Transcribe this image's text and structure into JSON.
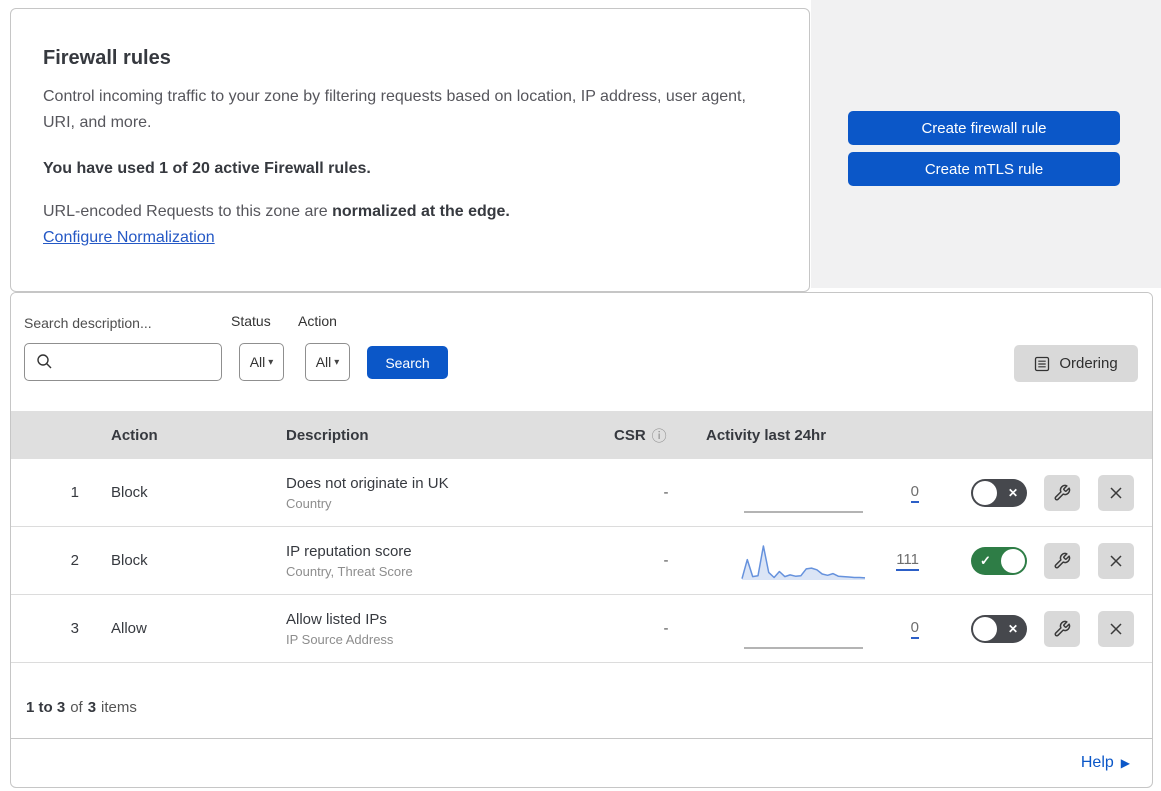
{
  "header": {
    "title": "Firewall rules",
    "description": "Control incoming traffic to your zone by filtering requests based on location, IP address, user agent, URI, and more.",
    "usage": "You have used 1 of 20 active Firewall rules.",
    "normalization_prefix": "URL-encoded Requests to this zone are ",
    "normalization_bold": "normalized at the edge.",
    "normalization_link": "Configure Normalization"
  },
  "actions_panel": {
    "create_firewall_label": "Create firewall rule",
    "create_mtls_label": "Create mTLS rule"
  },
  "filters": {
    "search_label": "Search description...",
    "status_label": "Status",
    "status_value": "All",
    "action_label": "Action",
    "action_value": "All",
    "search_button_label": "Search",
    "ordering_label": "Ordering"
  },
  "table": {
    "headers": {
      "action": "Action",
      "description": "Description",
      "csr": "CSR",
      "activity": "Activity last 24hr"
    },
    "rows": [
      {
        "priority": "1",
        "action": "Block",
        "description": "Does not originate in UK",
        "criteria": "Country",
        "csr": "-",
        "activity_count": "0",
        "enabled": false,
        "sparkline": []
      },
      {
        "priority": "2",
        "action": "Block",
        "description": "IP reputation score",
        "criteria": "Country, Threat Score",
        "csr": "-",
        "activity_count": "111",
        "enabled": true,
        "sparkline": [
          0.3,
          4.8,
          0.8,
          1.0,
          8,
          1.8,
          0.6,
          2.0,
          0.8,
          1.2,
          0.9,
          1.0,
          2.6,
          2.8,
          2.4,
          1.4,
          1.1,
          1.5,
          0.9,
          0.8,
          0.7,
          0.6,
          0.6,
          0.5
        ]
      },
      {
        "priority": "3",
        "action": "Allow",
        "description": "Allow listed IPs",
        "criteria": "IP Source Address",
        "csr": "-",
        "activity_count": "0",
        "enabled": false,
        "sparkline": []
      }
    ]
  },
  "footer": {
    "range": "1 to 3",
    "of": "of",
    "total": "3",
    "items": "items",
    "help_label": "Help"
  },
  "icons": {
    "dropdown_arrow": "▾",
    "check": "✓",
    "cross": "✕",
    "info": "ⓘ",
    "help_arrow": "▶"
  },
  "colors": {
    "primary_blue": "#0b57c8",
    "link_blue": "#2458c5",
    "toggle_on_green": "#2e7d46",
    "toggle_off_gray": "#46484d",
    "table_header_gray": "#dfdfdf",
    "panel_gray": "#f1f1f2",
    "icon_button_gray": "#d9d9d9",
    "sparkline_blue": "#6692dd"
  }
}
